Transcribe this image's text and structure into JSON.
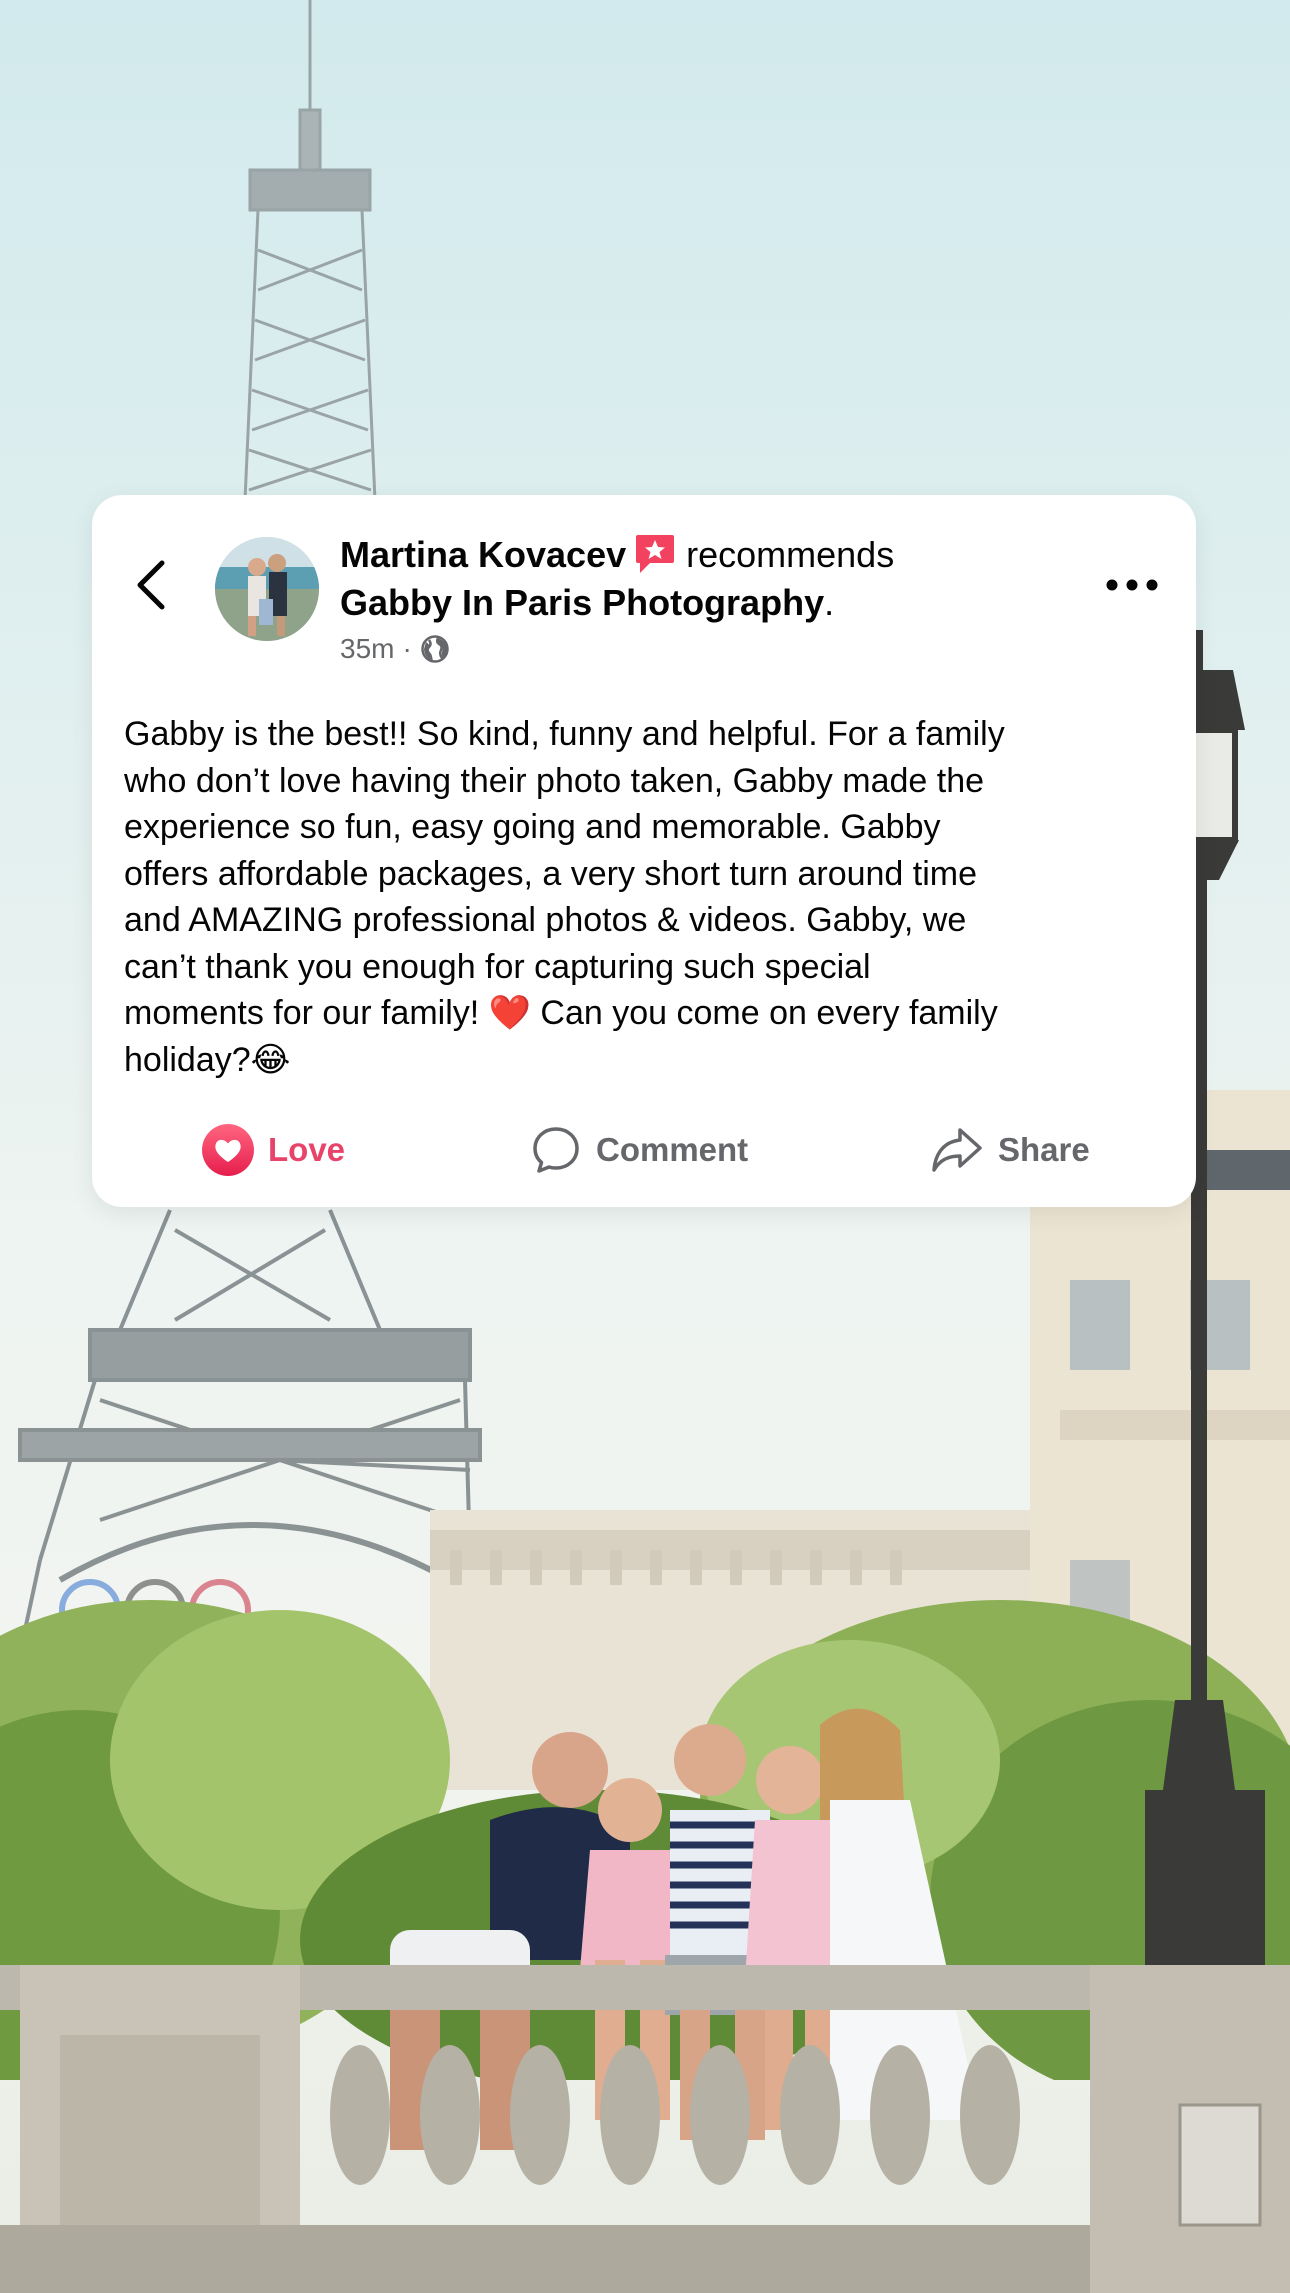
{
  "post": {
    "author": "Martina Kovacev",
    "recommends_word": "recommends",
    "page_name": "Gabby In Paris Photography",
    "page_suffix": ".",
    "time": "35m",
    "separator": "·",
    "body": "Gabby is the best!! So kind, funny and helpful. For a family\nwho don’t love having their photo taken, Gabby made the\nexperience so fun, easy going and memorable. Gabby\noffers affordable packages, a very short turn around time\nand AMAZING professional photos & videos. Gabby, we\ncan’t thank you enough for capturing such special\nmoments for our family! ❤️ Can you come on every family\nholiday?😂"
  },
  "actions": {
    "love_label": "Love",
    "comment_label": "Comment",
    "share_label": "Share"
  },
  "icons": {
    "back": "chevron-left-icon",
    "more": "more-horizontal-icon",
    "recommend": "recommend-star-icon",
    "audience": "globe-icon",
    "love": "heart-icon",
    "comment": "comment-bubble-icon",
    "share": "share-arrow-icon"
  },
  "colors": {
    "love_accent": "#e8446a",
    "secondary_text": "#65676b",
    "primary_text": "#050505",
    "card_background": "#ffffff"
  }
}
